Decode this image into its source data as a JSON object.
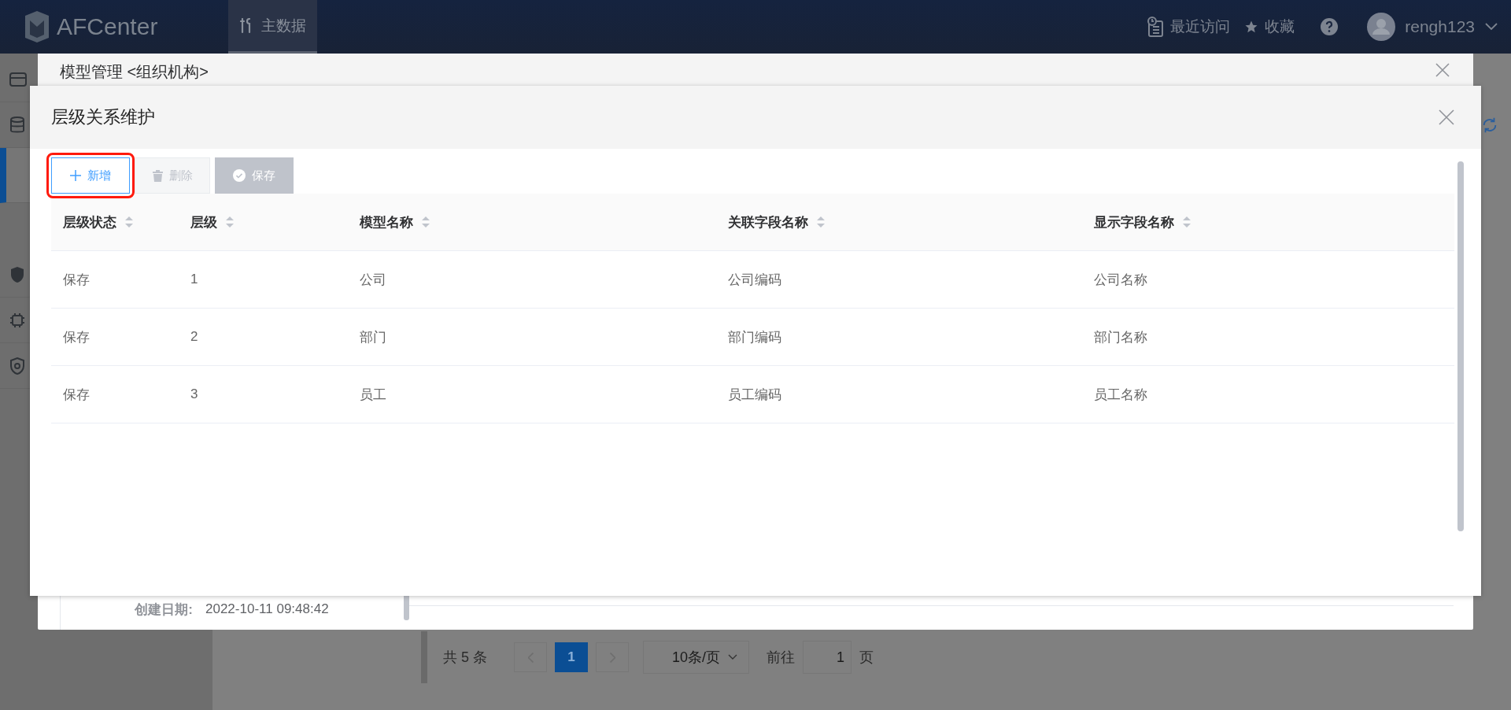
{
  "top_bar": {
    "logo": "AFCenter",
    "nav_tabs": [
      {
        "label": "主数据",
        "selected": true
      }
    ],
    "recent": "最近访问",
    "favorites": "收藏",
    "user": "rengh123"
  },
  "sidebar": {
    "items": [
      {
        "selected": false
      },
      {
        "selected": false
      },
      {
        "selected": true
      },
      {
        "selected": false
      },
      {
        "selected": false
      },
      {
        "selected": false
      }
    ]
  },
  "pagination": {
    "total": "共 5 条",
    "pages": [
      {
        "label": "1",
        "selected": true
      }
    ],
    "page_size": "10条/页",
    "goto_label": "前往",
    "goto_value": "1",
    "goto_suffix": "页"
  },
  "outer_dialog": {
    "title": "模型管理 <组织机构>",
    "detail_fields": [
      {
        "label": "创建日期:",
        "value": "2022-10-11 09:48:42"
      }
    ]
  },
  "dialog": {
    "title": "层级关系维护",
    "toolbar": [
      {
        "label": "新增",
        "kind": "add",
        "disabled": false,
        "highlighted": true
      },
      {
        "label": "删除",
        "kind": "delete",
        "disabled": true,
        "highlighted": false
      },
      {
        "label": "保存",
        "kind": "save",
        "disabled": true,
        "highlighted": false
      }
    ],
    "table": {
      "columns": [
        "层级状态",
        "层级",
        "模型名称",
        "关联字段名称",
        "显示字段名称"
      ],
      "rows": [
        [
          "保存",
          "1",
          "公司",
          "公司编码",
          "公司名称"
        ],
        [
          "保存",
          "2",
          "部门",
          "部门编码",
          "部门名称"
        ],
        [
          "保存",
          "3",
          "员工",
          "员工编码",
          "员工名称"
        ]
      ]
    }
  }
}
